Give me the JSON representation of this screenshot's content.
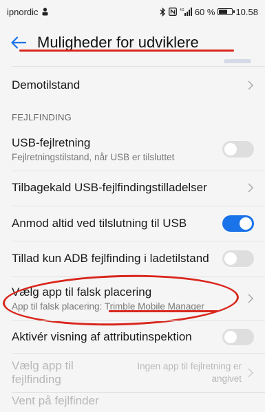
{
  "statusbar": {
    "carrier": "ipnordic",
    "battery": "60 %",
    "time": "10.58"
  },
  "header": {
    "title": "Muligheder for udviklere"
  },
  "rows": {
    "demo": {
      "label": "Demotilstand"
    },
    "section": {
      "label": "FEJLFINDING"
    },
    "usb_debug": {
      "label": "USB-fejlretning",
      "sub": "Fejlretningstilstand, når USB er tilsluttet",
      "state": "off"
    },
    "revoke": {
      "label": "Tilbagekald USB-fejlfindingstilladelser"
    },
    "ask_usb": {
      "label": "Anmod altid ved tilslutning til USB",
      "state": "on"
    },
    "adb_charge": {
      "label": "Tillad kun ADB fejlfinding i ladetilstand",
      "state": "off"
    },
    "mock_location": {
      "label": "Vælg app til falsk placering",
      "sub": "App til falsk placering: Trimble Mobile Manager"
    },
    "attr_inspect": {
      "label": "Aktivér visning af attributinspektion",
      "state": "off"
    },
    "debug_app": {
      "label": "Vælg app til fejlfinding",
      "hint": "Ingen app til fejlretning er angivet"
    },
    "wait_debugger": {
      "label": "Vent på fejlfinder"
    }
  },
  "colors": {
    "accent": "#1a73e8",
    "annotation": "#d9261c"
  }
}
